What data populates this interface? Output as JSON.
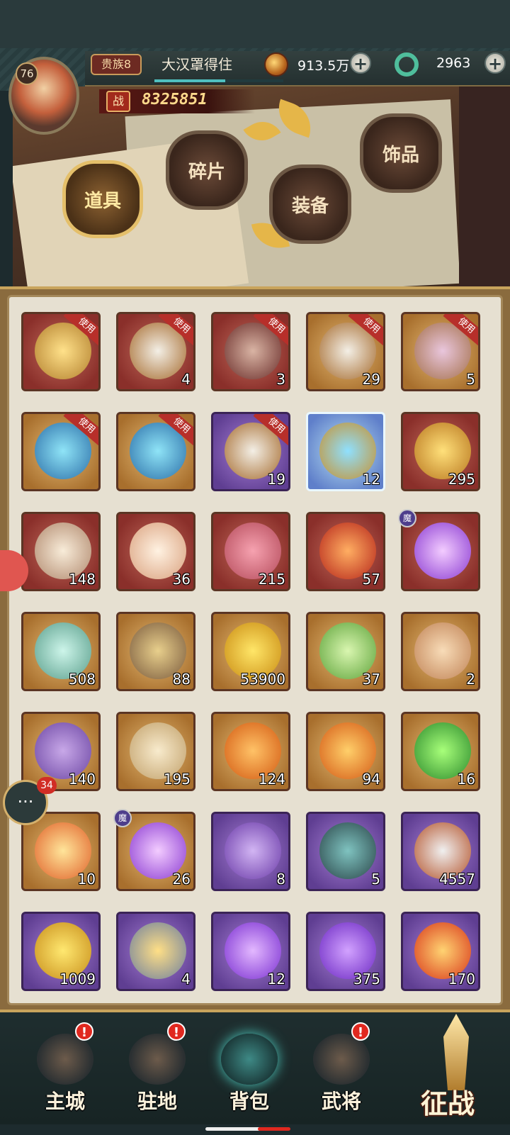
{
  "header": {
    "level": "76",
    "noble_rank": "贵族8",
    "player_name": "大汉罩得住",
    "coins": "913.5万",
    "jade": "2963",
    "power_label": "战",
    "power": "8325851",
    "exp_progress": 0.55
  },
  "tabs": [
    {
      "label": "道具",
      "active": true
    },
    {
      "label": "碎片",
      "active": false
    },
    {
      "label": "装备",
      "active": false
    },
    {
      "label": "饰品",
      "active": false
    }
  ],
  "use_label": "使用",
  "mo_label": "魔",
  "items": [
    {
      "icon": "card-icon",
      "bg": "red",
      "count": "",
      "use": true
    },
    {
      "icon": "orb-chest-icon",
      "bg": "red",
      "count": "4",
      "use": true
    },
    {
      "icon": "hero-chest-icon",
      "bg": "red",
      "count": "3",
      "use": true
    },
    {
      "icon": "orb-chest-icon",
      "bg": "gold",
      "count": "29",
      "use": true
    },
    {
      "icon": "trinket-chest-icon",
      "bg": "gold",
      "count": "5",
      "use": true
    },
    {
      "icon": "crystal-chest-icon",
      "bg": "gold",
      "count": "",
      "use": true
    },
    {
      "icon": "crystal-chest-icon",
      "bg": "gold",
      "count": "",
      "use": true
    },
    {
      "icon": "orb-chest-icon",
      "bg": "purple",
      "count": "19",
      "use": true
    },
    {
      "icon": "crest-icon",
      "bg": "blue",
      "count": "12",
      "use": false
    },
    {
      "icon": "dragon-coin-icon",
      "bg": "red",
      "count": "295",
      "use": false
    },
    {
      "icon": "horn-icon",
      "bg": "red",
      "count": "148",
      "use": false
    },
    {
      "icon": "shell-icon",
      "bg": "red",
      "count": "36",
      "use": false
    },
    {
      "icon": "pink-beast-icon",
      "bg": "red",
      "count": "215",
      "use": false
    },
    {
      "icon": "red-gem-icon",
      "bg": "red",
      "count": "57",
      "use": false
    },
    {
      "icon": "purple-orb-icon",
      "bg": "red",
      "count": "",
      "use": false,
      "mo": true
    },
    {
      "icon": "sword-emblem-icon",
      "bg": "gold",
      "count": "508",
      "use": false
    },
    {
      "icon": "helmet-emblem-icon",
      "bg": "gold",
      "count": "88",
      "use": false
    },
    {
      "icon": "golden-orb-icon",
      "bg": "gold",
      "count": "53900",
      "use": false
    },
    {
      "icon": "green-crystal-icon",
      "bg": "gold",
      "count": "37",
      "use": false
    },
    {
      "icon": "bun-icon",
      "bg": "gold",
      "count": "2",
      "use": false
    },
    {
      "icon": "scroll-icon",
      "bg": "gold",
      "count": "140",
      "use": false
    },
    {
      "icon": "jade-disc-icon",
      "bg": "gold",
      "count": "195",
      "use": false
    },
    {
      "icon": "fire-orb-icon",
      "bg": "gold",
      "count": "124",
      "use": false
    },
    {
      "icon": "amber-crystal-icon",
      "bg": "gold",
      "count": "94",
      "use": false
    },
    {
      "icon": "green-flame-icon",
      "bg": "gold",
      "count": "16",
      "use": false
    },
    {
      "icon": "campfire-icon",
      "bg": "gold",
      "count": "10",
      "use": false
    },
    {
      "icon": "purple-orb-icon",
      "bg": "gold",
      "count": "26",
      "use": false,
      "mo": true
    },
    {
      "icon": "talisman-icon",
      "bg": "purple",
      "count": "8",
      "use": false
    },
    {
      "icon": "dart-icon",
      "bg": "purple",
      "count": "5",
      "use": false
    },
    {
      "icon": "beast-blade-icon",
      "bg": "purple",
      "count": "4557",
      "use": false
    },
    {
      "icon": "ornament-icon",
      "bg": "purple",
      "count": "1009",
      "use": false
    },
    {
      "icon": "soup-bowl-icon",
      "bg": "purple",
      "count": "4",
      "use": false
    },
    {
      "icon": "violet-orb-icon",
      "bg": "purple",
      "count": "12",
      "use": false
    },
    {
      "icon": "violet-crystal-icon",
      "bg": "purple",
      "count": "375",
      "use": false
    },
    {
      "icon": "fire-sphere-icon",
      "bg": "purple",
      "count": "170",
      "use": false
    }
  ],
  "chat": {
    "badge": "34",
    "icon": "chat-icon"
  },
  "nav": [
    {
      "label": "主城",
      "icon": "city-icon",
      "badge": "!",
      "active": false
    },
    {
      "label": "驻地",
      "icon": "camp-icon",
      "badge": "!",
      "active": false
    },
    {
      "label": "背包",
      "icon": "bag-icon",
      "badge": "",
      "active": true
    },
    {
      "label": "武将",
      "icon": "general-icon",
      "badge": "!",
      "active": false
    }
  ],
  "battle_label": "征战",
  "colors": {
    "use_tag": "#b72f2a",
    "badge": "#e0281f",
    "accent_gold": "#e4bf6a"
  }
}
